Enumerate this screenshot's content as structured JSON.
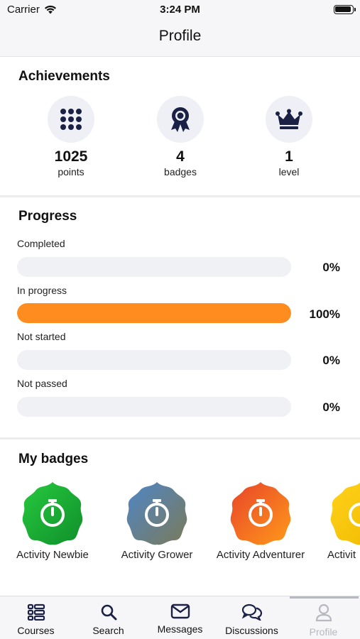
{
  "status": {
    "carrier": "Carrier",
    "time": "3:24 PM"
  },
  "header": {
    "title": "Profile"
  },
  "achievements": {
    "title": "Achievements",
    "items": [
      {
        "value": "1025",
        "label": "points",
        "icon": "grid-dots-icon"
      },
      {
        "value": "4",
        "label": "badges",
        "icon": "award-ribbon-icon"
      },
      {
        "value": "1",
        "label": "level",
        "icon": "crown-icon"
      }
    ]
  },
  "progress": {
    "title": "Progress",
    "items": [
      {
        "label": "Completed",
        "percent": "0%",
        "fraction": 0
      },
      {
        "label": "In progress",
        "percent": "100%",
        "fraction": 1
      },
      {
        "label": "Not started",
        "percent": "0%",
        "fraction": 0
      },
      {
        "label": "Not passed",
        "percent": "0%",
        "fraction": 0
      }
    ]
  },
  "badges": {
    "title": "My badges",
    "items": [
      {
        "label": "Activity Newbie",
        "color_a": "#27c93f",
        "color_b": "#0f8f2a",
        "icon": "stopwatch-icon"
      },
      {
        "label": "Activity Grower",
        "color_a": "#4f86c6",
        "color_b": "#7a7a5a",
        "icon": "stopwatch-icon"
      },
      {
        "label": "Activity Adventurer",
        "color_a": "#e8432a",
        "color_b": "#ff9a1a",
        "icon": "stopwatch-icon"
      },
      {
        "label": "Activit",
        "color_a": "#ffd21a",
        "color_b": "#f0b800",
        "icon": "stopwatch-icon"
      }
    ]
  },
  "tabbar": {
    "tabs": [
      {
        "label": "Courses",
        "icon": "courses-list-icon"
      },
      {
        "label": "Search",
        "icon": "search-icon"
      },
      {
        "label": "Messages",
        "icon": "envelope-icon"
      },
      {
        "label": "Discussions",
        "icon": "chat-bubbles-icon"
      },
      {
        "label": "Profile",
        "icon": "user-icon"
      }
    ],
    "active": "Profile"
  },
  "colors": {
    "accent": "#ff8c1f",
    "icon_dark": "#1b2145",
    "track": "#eff1f5",
    "inactive": "#b7b9c0"
  }
}
